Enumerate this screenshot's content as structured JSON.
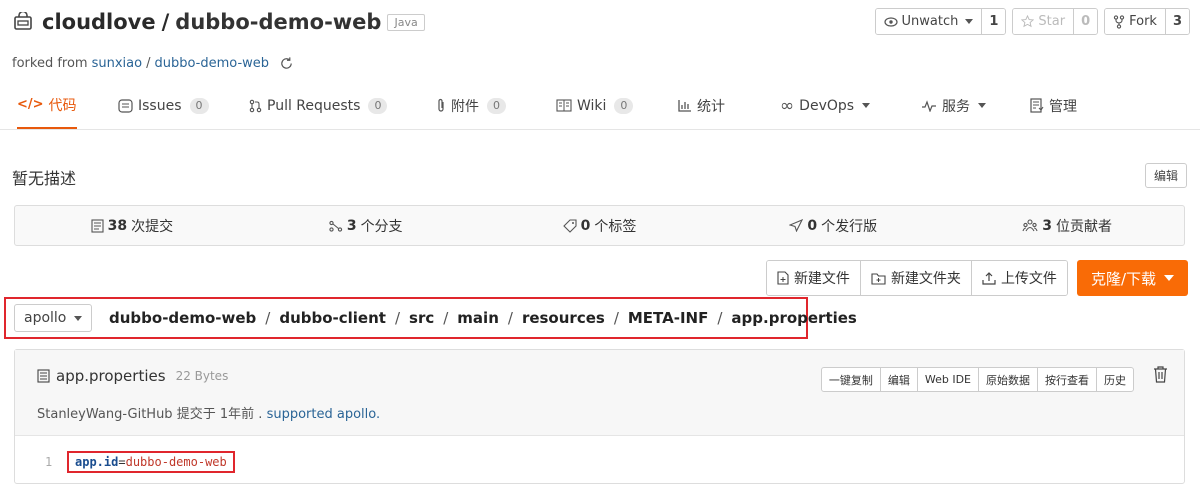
{
  "repo": {
    "owner": "cloudlove",
    "separator": "/",
    "name": "dubbo-demo-web",
    "language": "Java",
    "forked_prefix": "forked from",
    "forked_from_owner": "sunxiao",
    "forked_sep": "/",
    "forked_from_repo": "dubbo-demo-web"
  },
  "actions": {
    "watch_label": "Unwatch",
    "watch_count": "1",
    "star_label": "Star",
    "star_count": "0",
    "fork_label": "Fork",
    "fork_count": "3"
  },
  "nav": {
    "code": "代码",
    "issues": "Issues",
    "issues_count": "0",
    "pull_requests": "Pull Requests",
    "pull_requests_count": "0",
    "attachments": "附件",
    "attachments_count": "0",
    "wiki": "Wiki",
    "wiki_count": "0",
    "stats": "统计",
    "devops": "DevOps",
    "services": "服务",
    "manage": "管理"
  },
  "description": {
    "text": "暂无描述",
    "edit_label": "编辑"
  },
  "stats": {
    "commits_count": "38",
    "commits_label": "次提交",
    "branches_count": "3",
    "branches_label": "个分支",
    "tags_count": "0",
    "tags_label": "个标签",
    "releases_count": "0",
    "releases_label": "个发行版",
    "contributors_count": "3",
    "contributors_label": "位贡献者"
  },
  "file_actions": {
    "new_file": "新建文件",
    "new_folder": "新建文件夹",
    "upload_file": "上传文件",
    "clone_download": "克隆/下载"
  },
  "branch": "apollo",
  "breadcrumb": [
    "dubbo-demo-web",
    "dubbo-client",
    "src",
    "main",
    "resources",
    "META-INF",
    "app.properties"
  ],
  "file": {
    "name": "app.properties",
    "size": "22 Bytes",
    "commit_author": "StanleyWang-GitHub",
    "commit_verb": "提交于",
    "commit_time": "1年前",
    "commit_separator": ".",
    "commit_message": "supported apollo.",
    "tools": [
      "一键复制",
      "编辑",
      "Web IDE",
      "原始数据",
      "按行查看",
      "历史"
    ]
  },
  "code": {
    "line_number": "1",
    "key": "app.id",
    "equals": "=",
    "value": "dubbo-demo-web"
  },
  "colors": {
    "accent": "#e8590c",
    "clone_button": "#f96b06",
    "highlight_border": "#e0262d",
    "link": "#2a6496"
  }
}
